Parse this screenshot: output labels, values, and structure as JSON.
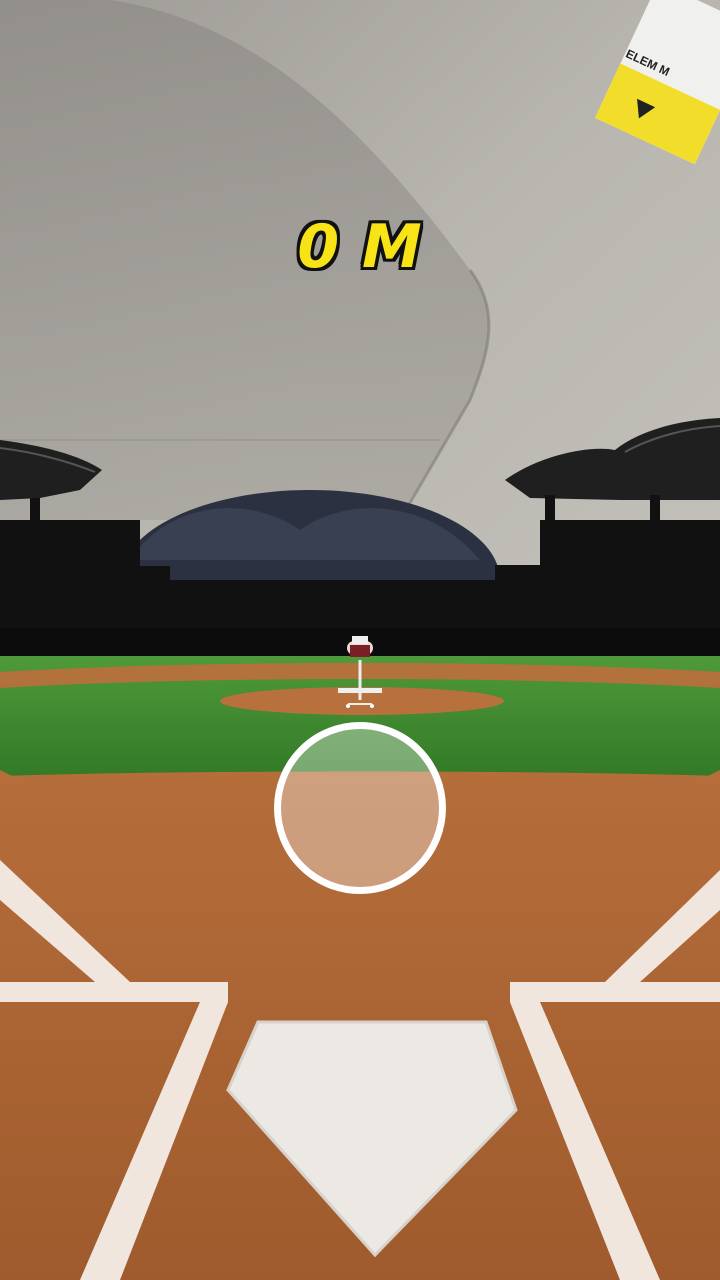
{
  "hud": {
    "distance": "0 M"
  },
  "sticker": {
    "text": "ELEM M"
  },
  "colors": {
    "distance_text": "#f7e316",
    "grass": "#3f8a2c",
    "dirt": "#b9703c",
    "chalk": "#f1e6de",
    "ceiling": "#b7b4ae"
  }
}
